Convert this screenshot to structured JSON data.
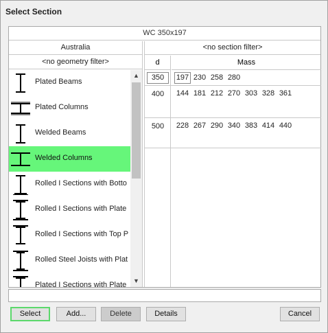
{
  "window": {
    "title": "Select Section"
  },
  "header": {
    "section_name": "WC 350x197"
  },
  "left": {
    "standard": "Australia",
    "geometry_filter": "<no geometry filter>",
    "items": [
      {
        "label": "Plated Beams",
        "icon": "i-beam-icon"
      },
      {
        "label": "Plated Columns",
        "icon": "column-section-icon"
      },
      {
        "label": "Welded Beams",
        "icon": "i-beam-icon"
      },
      {
        "label": "Welded Columns",
        "icon": "column-section-icon",
        "selected": true
      },
      {
        "label": "Rolled I Sections with Botto",
        "icon": "i-beam-icon"
      },
      {
        "label": "Rolled I Sections with Plate",
        "icon": "i-beam-icon"
      },
      {
        "label": "Rolled I Sections with Top P",
        "icon": "i-beam-icon"
      },
      {
        "label": "Rolled Steel Joists with Plat",
        "icon": "i-beam-icon"
      },
      {
        "label": "Plated I Sections with Plate",
        "icon": "i-beam-icon"
      }
    ],
    "selected_color": "#66f67a"
  },
  "right": {
    "section_filter": "<no section filter>",
    "col_d": "d",
    "col_mass": "Mass",
    "rows": [
      {
        "d": "350",
        "masses": [
          "197",
          "230",
          "258",
          "280"
        ]
      },
      {
        "d": "400",
        "masses": [
          "144",
          "181",
          "212",
          "270",
          "303",
          "328",
          "361"
        ]
      },
      {
        "d": "500",
        "masses": [
          "228",
          "267",
          "290",
          "340",
          "383",
          "414",
          "440"
        ]
      }
    ]
  },
  "buttons": {
    "select": "Select",
    "add": "Add...",
    "delete": "Delete",
    "details": "Details",
    "cancel": "Cancel"
  }
}
